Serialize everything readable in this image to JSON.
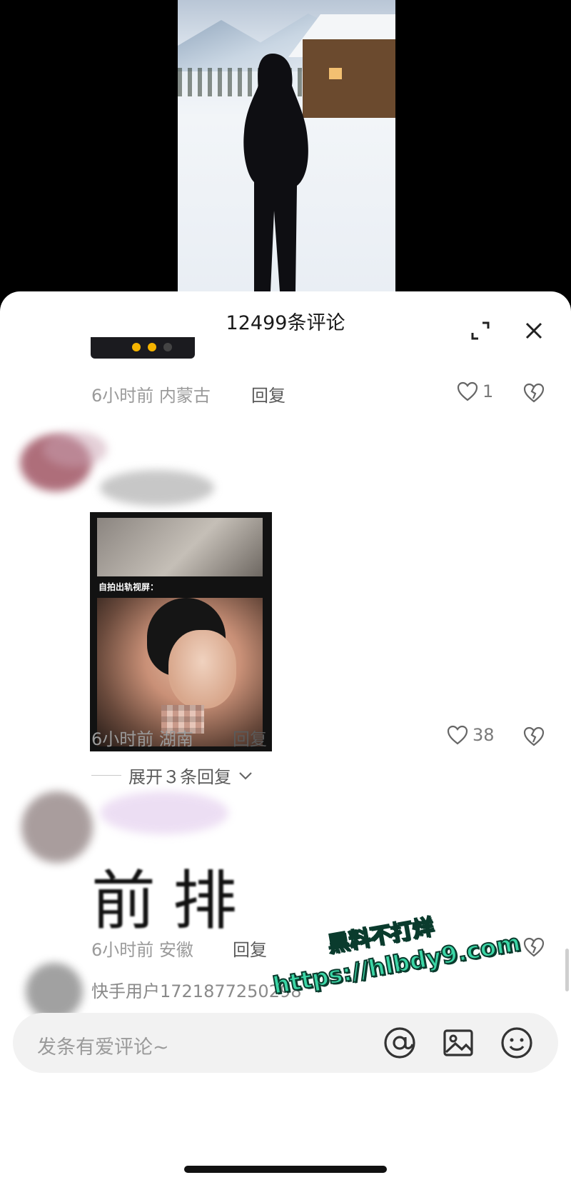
{
  "panel": {
    "title": "12499条评论"
  },
  "comments": [
    {
      "time_location": "6小时前 内蒙古",
      "reply_label": "回复",
      "likes": "1"
    },
    {
      "image_caption": "自拍出轨视屏：",
      "time_location": "6小时前 湖南",
      "reply_label": "回复",
      "likes": "38",
      "expand_label": "展开３条回复"
    },
    {
      "text": "前排",
      "time_location": "6小时前 安徽",
      "reply_label": "回复"
    }
  ],
  "next_user": "快手用户1721877250298",
  "input": {
    "placeholder": "发条有爱评论~"
  },
  "watermark": {
    "line1": "黑料不打烊",
    "line2": "https://hlbdy9.com"
  },
  "colors": {
    "accent": "#3bd6a6",
    "panel_bg": "#ffffff",
    "input_bg": "#f2f2f2"
  },
  "icons": [
    "expand-icon",
    "close-icon",
    "heart-icon",
    "broken-heart-icon",
    "at-icon",
    "image-icon",
    "emoji-icon",
    "chevron-down-icon"
  ]
}
